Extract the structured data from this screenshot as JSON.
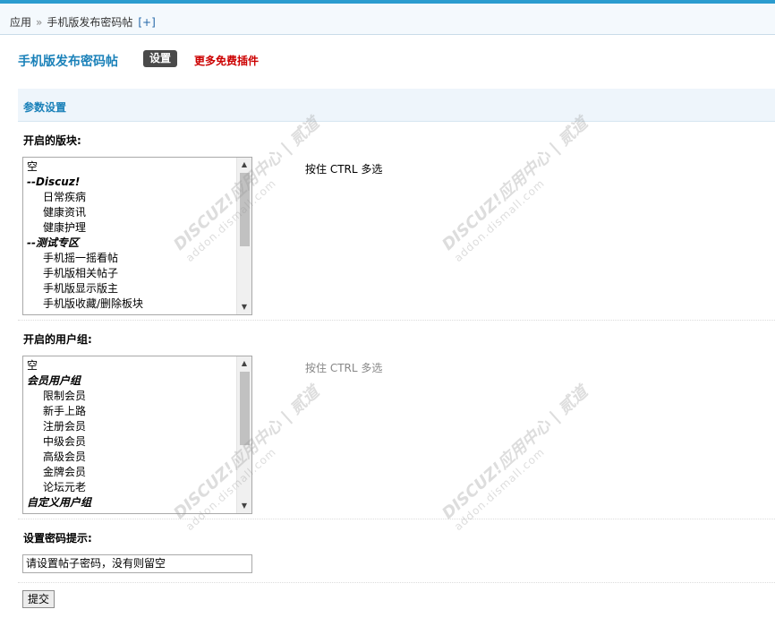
{
  "breadcrumb": {
    "root": "应用",
    "separator": "»",
    "current": "手机版发布密码帖",
    "add": "[+]"
  },
  "header": {
    "title": "手机版发布密码帖",
    "tab_settings": "设置",
    "more_plugins": "更多免费插件"
  },
  "section": {
    "title": "参数设置"
  },
  "forums_field": {
    "label": "开启的版块:",
    "hint": "按住 CTRL 多选",
    "options": [
      {
        "label": "空",
        "kind": "item"
      },
      {
        "label": "--Discuz!",
        "kind": "group"
      },
      {
        "label": "日常疾病",
        "kind": "child"
      },
      {
        "label": "健康资讯",
        "kind": "child"
      },
      {
        "label": "健康护理",
        "kind": "child"
      },
      {
        "label": "--测试专区",
        "kind": "group"
      },
      {
        "label": "手机摇一摇看帖",
        "kind": "child"
      },
      {
        "label": "手机版相关帖子",
        "kind": "child"
      },
      {
        "label": "手机版显示版主",
        "kind": "child"
      },
      {
        "label": "手机版收藏/删除板块",
        "kind": "child"
      }
    ]
  },
  "groups_field": {
    "label": "开启的用户组:",
    "hint": "按住 CTRL 多选",
    "options": [
      {
        "label": "空",
        "kind": "item"
      },
      {
        "label": "会员用户组",
        "kind": "group"
      },
      {
        "label": "限制会员",
        "kind": "child"
      },
      {
        "label": "新手上路",
        "kind": "child"
      },
      {
        "label": "注册会员",
        "kind": "child"
      },
      {
        "label": "中级会员",
        "kind": "child"
      },
      {
        "label": "高级会员",
        "kind": "child"
      },
      {
        "label": "金牌会员",
        "kind": "child"
      },
      {
        "label": "论坛元老",
        "kind": "child"
      },
      {
        "label": "自定义用户组",
        "kind": "group"
      }
    ]
  },
  "password_hint_field": {
    "label": "设置密码提示:",
    "value": "请设置帖子密码，没有则留空"
  },
  "submit_label": "提交",
  "watermark": {
    "line1": "DISCUZ!应用中心 | 贰道",
    "line2": "addon.dismall.com"
  },
  "colors": {
    "accent": "#1a81b9",
    "top_bar": "#2b9ccf",
    "link_red": "#cc0000",
    "tab_bg": "#4a4a4a"
  }
}
